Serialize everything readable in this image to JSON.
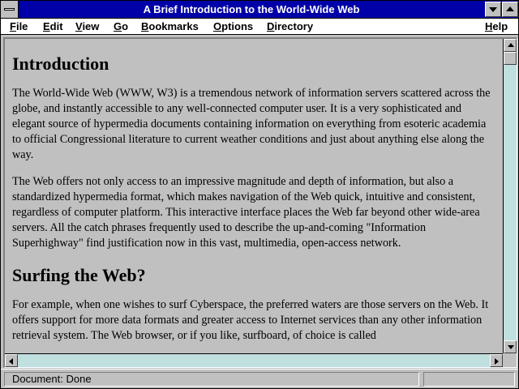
{
  "window": {
    "title": "A Brief Introduction to the World-Wide Web"
  },
  "menu": {
    "file": "File",
    "edit": "Edit",
    "view": "View",
    "go": "Go",
    "bookmarks": "Bookmarks",
    "options": "Options",
    "directory": "Directory",
    "help": "Help"
  },
  "document": {
    "heading1": "Introduction",
    "paragraph1": "The World-Wide Web (WWW, W3) is a tremendous network of information servers scattered across the globe, and instantly accessible to any well-connected computer user. It is a very sophisticated and elegant source of hypermedia documents containing information on everything from esoteric academia to official Congressional literature to current weather conditions and just about anything else along the way.",
    "paragraph2": "The Web offers not only access to an impressive magnitude and depth of information, but also a standardized hypermedia format, which makes navigation of the Web quick, intuitive and consistent, regardless of computer platform. This interactive interface places the Web far beyond other wide-area servers. All the catch phrases frequently used to describe the up-and-coming \"Information Superhighway\" find justification now in this vast, multimedia, open-access network.",
    "heading2": "Surfing the Web?",
    "paragraph3": "For example, when one wishes to surf Cyberspace, the preferred waters are those servers on the Web. It offers support for more data formats and greater access to Internet services than any other information retrieval system. The Web browser, or if you like, surfboard, of choice is called"
  },
  "status": {
    "text": "Document: Done"
  },
  "colors": {
    "titlebar": "#0000a8",
    "scroll_track": "#c0e0e0",
    "chrome": "#c0c0c0"
  },
  "icons": {
    "system_menu": "system-menu-icon",
    "minimize": "minimize-icon",
    "maximize": "maximize-icon"
  }
}
